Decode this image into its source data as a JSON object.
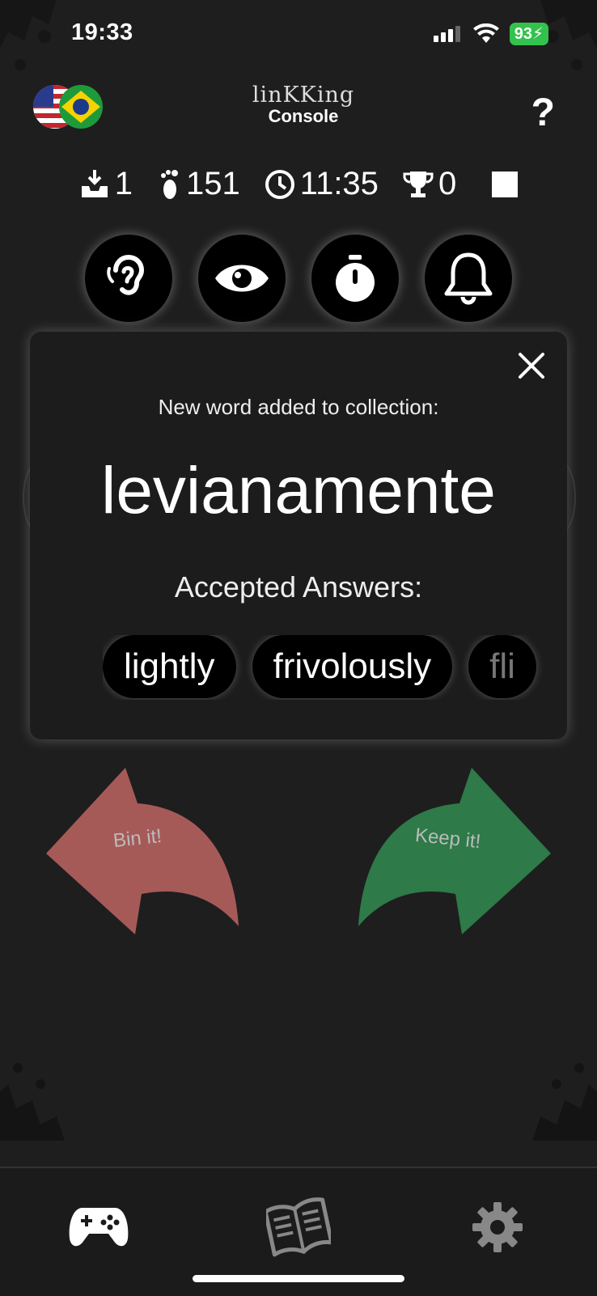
{
  "status_bar": {
    "time": "19:33",
    "battery": "93"
  },
  "header": {
    "logo_title": "linKKing",
    "logo_subtitle": "Console",
    "help_label": "?",
    "flags": [
      "us-flag-icon",
      "brazil-flag-icon"
    ]
  },
  "stats": {
    "queue_count": "1",
    "steps_count": "151",
    "time_value": "11:35",
    "trophy_count": "0"
  },
  "action_buttons": [
    "ear-icon",
    "eye-icon",
    "stopwatch-icon",
    "bell-icon"
  ],
  "modal": {
    "heading": "New word added to collection:",
    "word": "levianamente",
    "accepted_label": "Accepted Answers:",
    "answers": [
      "lightly",
      "frivolously",
      "fli"
    ]
  },
  "swipe": {
    "bin_label": "Bin it!",
    "keep_label": "Keep it!",
    "bin_color": "#a65a58",
    "keep_color": "#2e7a48"
  },
  "bottom_nav": [
    "gamepad-icon",
    "book-icon",
    "gear-icon"
  ]
}
